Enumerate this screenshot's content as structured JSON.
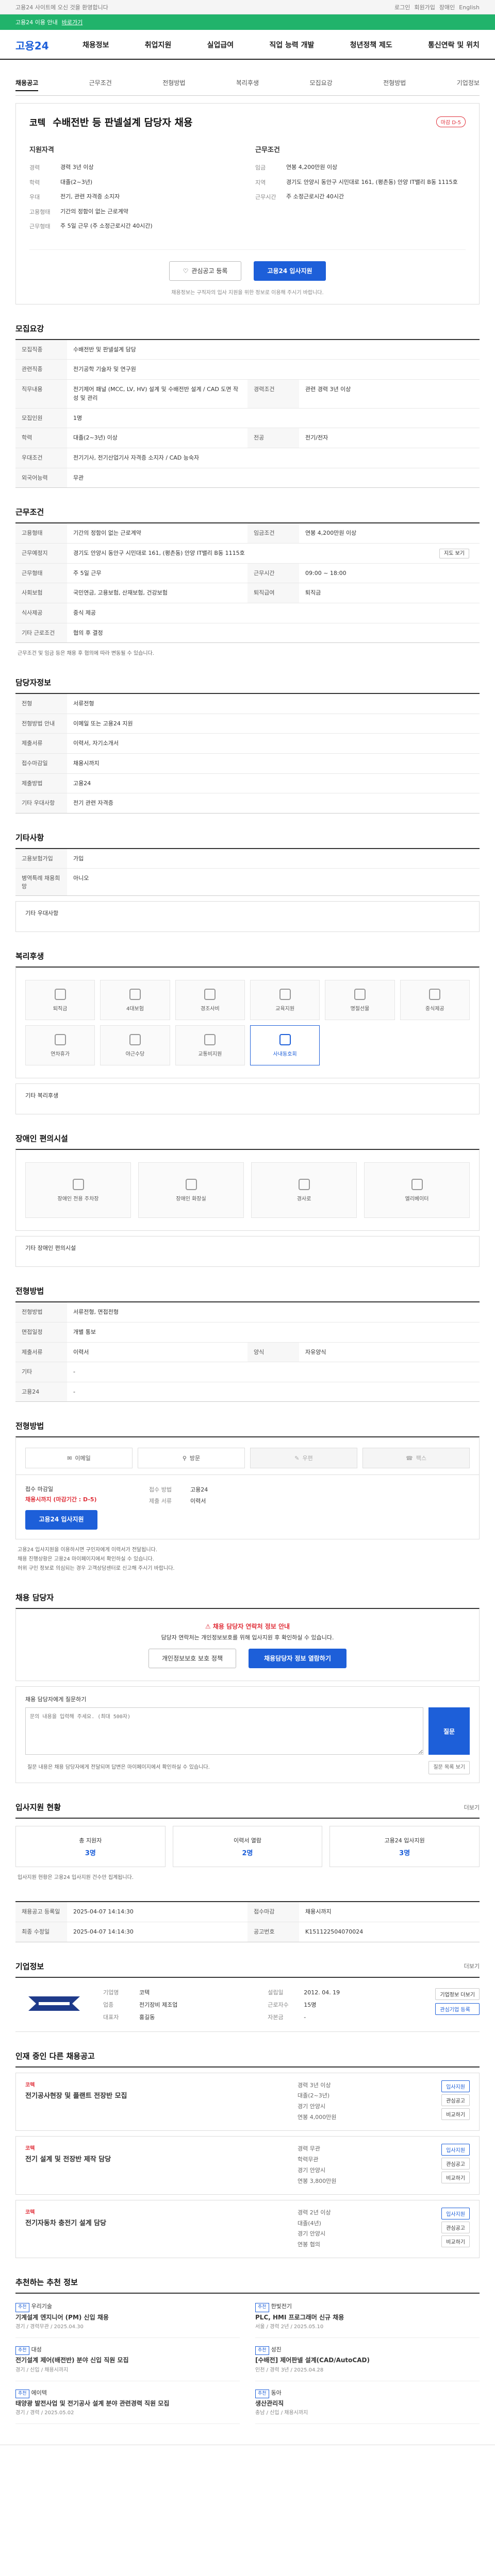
{
  "topbar": {
    "notice": "고용24 사이트에 오신 것을 환영합니다",
    "links": [
      "로그인",
      "회원가입",
      "장애인",
      "English"
    ]
  },
  "greenbar": {
    "text": "고용24 이용 안내",
    "link": "바로가기"
  },
  "gnb": {
    "logo": "고용24",
    "menu": [
      "채용정보",
      "취업지원",
      "실업급여",
      "직업 능력 개발",
      "청년정책 제도",
      "통신연락 및 위치"
    ]
  },
  "tabs": [
    "채용공고",
    "근무조건",
    "전형방법",
    "복리후생",
    "모집요강",
    "전형방법",
    "기업정보"
  ],
  "job": {
    "company": "코텍",
    "title": "수배전반 등 판넬설계 담당자 채용",
    "dday": "마감 D-5",
    "left_title": "지원자격",
    "left": [
      [
        "경력",
        "경력 3년 이상"
      ],
      [
        "학력",
        "대졸(2~3년)"
      ],
      [
        "우대",
        "전기, 관련 자격증 소지자"
      ],
      [
        "고용형태",
        "기간의 정함이 없는 근로계약"
      ],
      [
        "근무형태",
        "주 5일 근무 (주 소정근로시간 40시간)"
      ]
    ],
    "right_title": "근무조건",
    "right": [
      [
        "임금",
        "연봉 4,200만원 이상"
      ],
      [
        "지역",
        "경기도 안양시 동안구 시민대로 161, (평촌동) 안양 IT밸리 B동 1115호"
      ],
      [
        "근무시간",
        "주 소정근로시간 40시간"
      ]
    ],
    "btn_save": "관심공고 등록",
    "btn_apply": "고용24 입사지원",
    "note": "채용정보는 구직자의 입사 지원을 위한 정보로 이용해 주시기 바랍니다."
  },
  "recruit": {
    "title": "모집요강",
    "rows": [
      [
        "모집직종",
        "수배전반 및 판넬설계 담당",
        "",
        ""
      ],
      [
        "관련직종",
        "전기공학 기술자 및 연구원",
        "",
        ""
      ],
      [
        "직무내용",
        "전기제어 패널 (MCC, LV, HV) 설계 및 수배전반 설계 / CAD 도면 작성 및 관리",
        "경력조건",
        "관련 경력 3년 이상"
      ],
      [
        "모집인원",
        "1명",
        "",
        ""
      ],
      [
        "학력",
        "대졸(2~3년) 이상",
        "전공",
        "전기/전자"
      ],
      [
        "우대조건",
        "전기기사, 전기산업기사 자격증 소지자 / CAD 능숙자",
        "",
        ""
      ],
      [
        "외국어능력",
        "무관",
        "",
        ""
      ]
    ]
  },
  "work": {
    "title": "근무조건",
    "rows": [
      [
        "고용형태",
        "기간의 정함이 없는 근로계약",
        "임금조건",
        "연봉 4,200만원 이상"
      ],
      [
        "근무예정지",
        "경기도 안양시 동안구 시민대로 161, (평촌동) 안양 IT밸리 B동 1115호",
        "",
        ""
      ],
      [
        "근무형태",
        "주 5일 근무",
        "근무시간",
        "09:00 ~ 18:00"
      ],
      [
        "사회보험",
        "국민연금, 고용보험, 산재보험, 건강보험",
        "퇴직급여",
        "퇴직금"
      ],
      [
        "식사제공",
        "중식 제공",
        "",
        ""
      ],
      [
        "기타 근로조건",
        "협의 후 결정",
        "",
        ""
      ]
    ],
    "note": "근무조건 및 임금 등은 채용 후 협의에 따라 변동될 수 있습니다."
  },
  "contact": {
    "title": "담당자정보",
    "rows": [
      [
        "전형",
        "서류전형"
      ],
      [
        "전형방법 안내",
        "이메일 또는 고용24 지원"
      ],
      [
        "제출서류",
        "이력서, 자기소개서"
      ],
      [
        "접수마감일",
        "채용시까지"
      ],
      [
        "제출방법",
        "고용24"
      ],
      [
        "기타 우대사항",
        "전기 관련 자격증"
      ]
    ]
  },
  "etc": {
    "title": "기타사항",
    "rows": [
      [
        "고용보험가입",
        "가입"
      ],
      [
        "병역특례 채용희망",
        "아니오"
      ]
    ],
    "pre": "기타 우대사항"
  },
  "welfare": {
    "title": "복리후생",
    "items": [
      "퇴직금",
      "4대보험",
      "경조사비",
      "교육지원",
      "명절선물",
      "중식제공",
      "연차휴가",
      "야근수당",
      "교통비지원",
      "사내동호회"
    ],
    "active": 9,
    "sub_title": "기타 복리후생"
  },
  "disability": {
    "title": "장애인 편의시설",
    "items": [
      "장애인 전용 주차장",
      "장애인 화장실",
      "경사로",
      "엘리베이터"
    ],
    "sub_title": "기타 장애인 편의시설"
  },
  "method": {
    "title": "전형방법",
    "rows": [
      [
        "전형방법",
        "서류전형, 면접전형",
        "",
        ""
      ],
      [
        "면접일정",
        "개별 통보",
        "",
        ""
      ],
      [
        "제출서류",
        "이력서",
        "양식",
        "자유양식"
      ],
      [
        "기타",
        "-",
        "",
        ""
      ],
      [
        "고용24",
        "-",
        "",
        ""
      ]
    ]
  },
  "apply": {
    "title": "전형방법",
    "types": [
      "이메일",
      "방문",
      "우편",
      "팩스"
    ],
    "left": [
      "접수 마감일",
      "채용시까지 (마감기간 : D-5)",
      "고용24 입사지원"
    ],
    "right_k": [
      "접수 방법",
      "제출 서류"
    ],
    "right_v": [
      "고용24",
      "이력서"
    ],
    "notes": [
      "고용24 입사지원을 이용하시면 구인자에게 이력서가 전달됩니다.",
      "채용 진행상황은 고용24 마이페이지에서 확인하실 수 있습니다.",
      "허위 구인 정보로 의심되는 경우 고객상담센터로 신고해 주시기 바랍니다."
    ]
  },
  "inquiry": {
    "title": "채용 담당자",
    "alert": "채용 담당자 연락처 정보 안내",
    "text": "담당자 연락처는 개인정보보호를 위해 입사지원 후 확인하실 수 있습니다.",
    "btn1": "개인정보보호 보호 정책",
    "btn2": "채용담당자 정보 열람하기",
    "q_title": "채용 담당자에게 질문하기",
    "q_placeholder": "문의 내용을 입력해 주세요. (최대 500자)",
    "q_btn": "질문",
    "q_note": "질문 내용은 채용 담당자에게 전달되며 답변은 마이페이지에서 확인하실 수 있습니다.",
    "q_link": "질문 목록 보기"
  },
  "stats": {
    "title": "입사지원 현황",
    "more": "더보기",
    "items": [
      [
        "총 지원자",
        "3명"
      ],
      [
        "이력서 열람",
        "2명"
      ],
      [
        "고용24 입사지원",
        "3명"
      ]
    ],
    "note": "입사지원 현황은 고용24 입사지원 건수만 집계됩니다."
  },
  "org": {
    "title": "기업정보",
    "more": "더보기",
    "reg": [
      [
        "채용공고 등록일",
        "2025-04-07 14:14:30"
      ],
      [
        "접수마감",
        "채용시까지"
      ],
      [
        "최종 수정일",
        "2025-04-07 14:14:30"
      ],
      [
        "공고번호",
        "K151122504070024"
      ]
    ],
    "name": "코텍",
    "info": [
      [
        "기업명",
        "코텍"
      ],
      [
        "설립일",
        "2012. 04. 19"
      ],
      [
        "업종",
        "전기장비 제조업"
      ],
      [
        "근로자수",
        "15명"
      ],
      [
        "대표자",
        "홍길동"
      ],
      [
        "자본금",
        "-"
      ]
    ],
    "btns": [
      "기업정보 더보기",
      "관심기업 등록"
    ]
  },
  "same": {
    "title": "인재 중인 다른 채용공고",
    "jobs": [
      {
        "company": "코텍",
        "title": "전기공사현장 및 플랜트 전장반 모집",
        "meta": [
          "경력 3년 이상",
          "대졸(2~3년)",
          "경기 안양시",
          "연봉 4,000만원"
        ]
      },
      {
        "company": "코텍",
        "title": "전기 설계 및 전장반 제작 담당",
        "meta": [
          "경력 무관",
          "학력무관",
          "경기 안양시",
          "연봉 3,800만원"
        ]
      },
      {
        "company": "코텍",
        "title": "전기자동차 충전기 설계 담당",
        "meta": [
          "경력 2년 이상",
          "대졸(4년)",
          "경기 안양시",
          "연봉 협의"
        ]
      }
    ],
    "btns": [
      "입사지원",
      "관심공고",
      "비교하기"
    ]
  },
  "recs": {
    "title": "추천하는 추천 정보",
    "items": [
      {
        "tag": "추천",
        "co": "우리기술",
        "title": "기계설계 엔지니어 (PM) 신입 채용",
        "sub": "경기 / 경력무관 / 2025.04.30"
      },
      {
        "tag": "추천",
        "co": "한빛전기",
        "title": "PLC, HMI 프로그래머 신규 채용",
        "sub": "서울 / 경력 2년 / 2025.05.10"
      },
      {
        "tag": "추천",
        "co": "대성",
        "title": "전기설계 제어(배전반) 분야 신입 직원 모집",
        "sub": "경기 / 신입 / 채용시까지"
      },
      {
        "tag": "추천",
        "co": "성진",
        "title": "[수배전] 제어판넬 설계(CAD/AutoCAD)",
        "sub": "인천 / 경력 3년 / 2025.04.28"
      },
      {
        "tag": "추천",
        "co": "에이텍",
        "title": "태양광 발전사업 및 전기공사 설계 분야 관련경력 직원 모집",
        "sub": "경기 / 경력 / 2025.05.02"
      },
      {
        "tag": "추천",
        "co": "동아",
        "title": "생산관리직",
        "sub": "충남 / 신입 / 채용시까지"
      }
    ]
  }
}
